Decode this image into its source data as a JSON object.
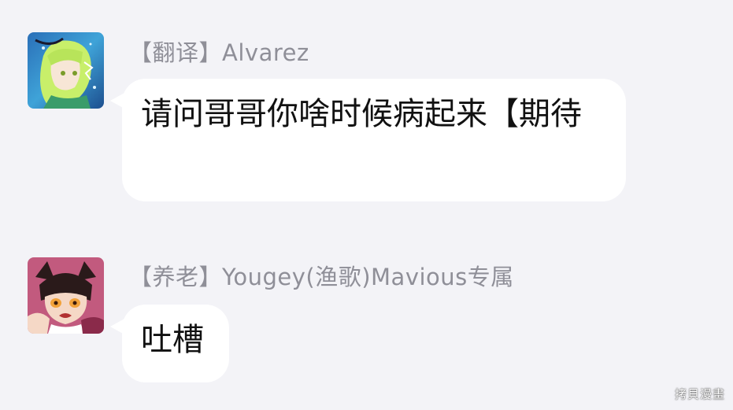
{
  "messages": [
    {
      "sender_tag": "【翻译】",
      "sender_name": "Alvarez",
      "text": "请问哥哥你啥时候病起来【期待",
      "avatar": "anime-avatar-green-hair"
    },
    {
      "sender_tag": "【养老】",
      "sender_name": "Yougey(渔歌)Mavious专属",
      "text": "吐槽",
      "avatar": "anime-avatar-dark-hair-cat-ears"
    }
  ],
  "watermark": "拷貝漫畫",
  "colors": {
    "background": "#f3f3f7",
    "bubble": "#ffffff",
    "sender_text": "#8f8f98",
    "message_text": "#111111"
  }
}
